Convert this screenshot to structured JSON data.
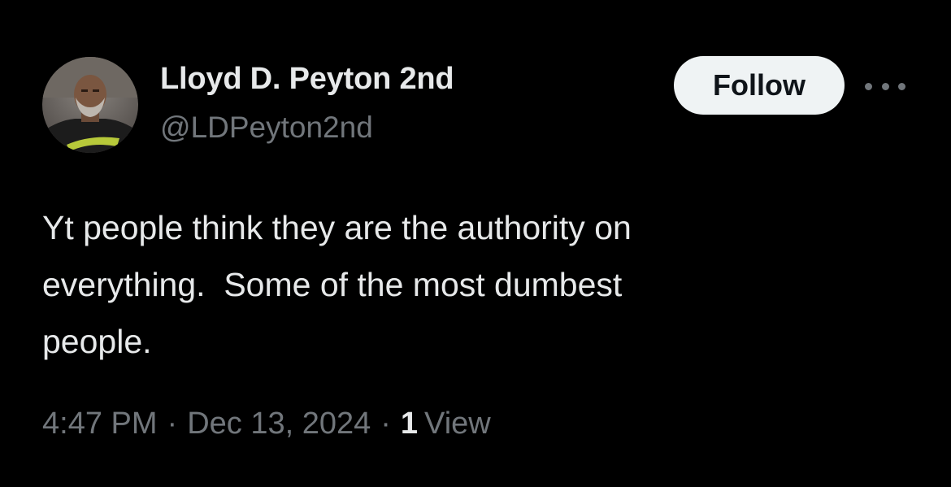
{
  "user": {
    "display_name": "Lloyd D. Peyton 2nd",
    "handle": "@LDPeyton2nd"
  },
  "actions": {
    "follow_label": "Follow",
    "more_icon": "more-horizontal-icon"
  },
  "tweet": {
    "text": "Yt people think they are the authority on\neverything.  Some of the most dumbest\npeople.",
    "time": "4:47 PM",
    "separator": "·",
    "date": "Dec 13, 2024",
    "views_count": "1",
    "views_label": "View"
  },
  "colors": {
    "background": "#000000",
    "primary_text": "#e7e9ea",
    "secondary_text": "#71767b",
    "follow_bg": "#eff3f4",
    "follow_text": "#0f1419"
  }
}
